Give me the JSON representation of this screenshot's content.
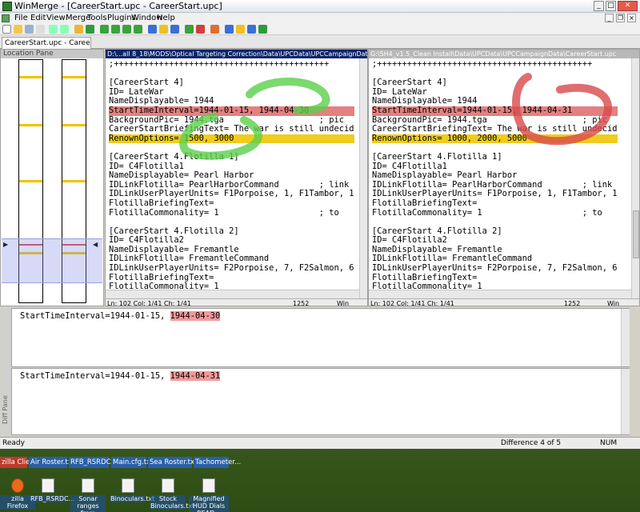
{
  "window": {
    "title": "WinMerge - [CareerStart.upc - CareerStart.upc]"
  },
  "menu": [
    "File",
    "Edit",
    "View",
    "Merge",
    "Tools",
    "Plugins",
    "Window",
    "Help"
  ],
  "tab": {
    "label": "CareerStart.upc - CareerStart.upc"
  },
  "location_pane": {
    "title": "Location Pane"
  },
  "left_pane": {
    "path": "D:\\...all 8_18\\MODS\\Optical Targeting Correction\\Data\\UPCData\\UPCCampaignData\\CareerStart.upc",
    "lines": [
      ";+++++++++++++++++++++++++++++++++++++++++++",
      "",
      "[CareerStart 4]",
      "ID= LateWar",
      "NameDisplayable= 1944",
      "StartTimeInterval=1944-01-15, 1944-04-30",
      "BackgroundPic= 1944.tga                   ; pic",
      "CareerStartBriefingText= The war is still undecid",
      "RenownOptions= 1500, 3000",
      "",
      "[CareerStart 4.Flotilla 1]",
      "ID= C4Flotilla1",
      "NameDisplayable= Pearl Harbor",
      "IDLinkFlotilla= PearlHarborCommand        ; link",
      "IDLinkUserPlayerUnits= F1Porpoise, 1, F1Tambor, 1",
      "FlotillaBriefingText=",
      "FlotillaCommonality= 1                    ; to",
      "",
      "[CareerStart 4.Flotilla 2]",
      "ID= C4Flotilla2",
      "NameDisplayable= Fremantle",
      "IDLinkFlotilla= FremantleCommand",
      "IDLinkUserPlayerUnits= F2Porpoise, 7, F2Salmon, 6",
      "FlotillaBriefingText=",
      "FlotillaCommonality= 1"
    ],
    "status": {
      "pos": "Ln: 102  Col: 1/41  Ch: 1/41",
      "encoding": "1252",
      "eol": "Win"
    }
  },
  "right_pane": {
    "path": "G:\\SH4_v1.5_Clean Install\\Data\\UPCData\\UPCCampaignData\\CareerStart.upc",
    "lines": [
      ";+++++++++++++++++++++++++++++++++++++++++++",
      "",
      "[CareerStart 4]",
      "ID= LateWar",
      "NameDisplayable= 1944",
      "StartTimeInterval=1944-01-15, 1944-04-31",
      "BackgroundPic= 1944.tga                   ; pic",
      "CareerStartBriefingText= The war is still undecid",
      "RenownOptions= 1000, 2000, 5000",
      "",
      "[CareerStart 4.Flotilla 1]",
      "ID= C4Flotilla1",
      "NameDisplayable= Pearl Harbor",
      "IDLinkFlotilla= PearlHarborCommand        ; link",
      "IDLinkUserPlayerUnits= F1Porpoise, 1, F1Tambor, 1",
      "FlotillaBriefingText=",
      "FlotillaCommonality= 1                    ; to",
      "",
      "[CareerStart 4.Flotilla 2]",
      "ID= C4Flotilla2",
      "NameDisplayable= Fremantle",
      "IDLinkFlotilla= FremantleCommand",
      "IDLinkUserPlayerUnits= F2Porpoise, 7, F2Salmon, 6",
      "FlotillaBriefingText=",
      "FlotillaCommonality= 1"
    ],
    "status": {
      "pos": "Ln: 102  Col: 1/41  Ch: 1/41",
      "encoding": "1252",
      "eol": "Win"
    }
  },
  "diff_pane": {
    "title": "Diff Pane",
    "left_prefix": "StartTimeInterval=1944-01-15, ",
    "left_changed": "1944-04-30",
    "right_prefix": "StartTimeInterval=1944-01-15, ",
    "right_changed": "1944-04-31"
  },
  "statusbar": {
    "ready": "Ready",
    "difference": "Difference 4 of 5",
    "num": "NUM"
  },
  "taskbar": [
    "zilla Client",
    "Air Roster.txt",
    "RFB_RSRDC...",
    "Main.cfg.txt",
    "Sea Roster.txt",
    "Tachometer..."
  ],
  "desktop_icons": [
    {
      "label": "zilla Firefox"
    },
    {
      "label": "RFB_RSRDC..."
    },
    {
      "label": "Sonar ranges from Wikip..."
    },
    {
      "label": "Binoculars.txt"
    },
    {
      "label": "Stock Binoculars.txt"
    },
    {
      "label": "Magnified HUD Dials READ..."
    }
  ],
  "colors": {
    "selected_diff": "#e58080",
    "diff": "#efcc1d",
    "green_annotation": "#5ad04a",
    "red_annotation": "#d84a4a"
  }
}
